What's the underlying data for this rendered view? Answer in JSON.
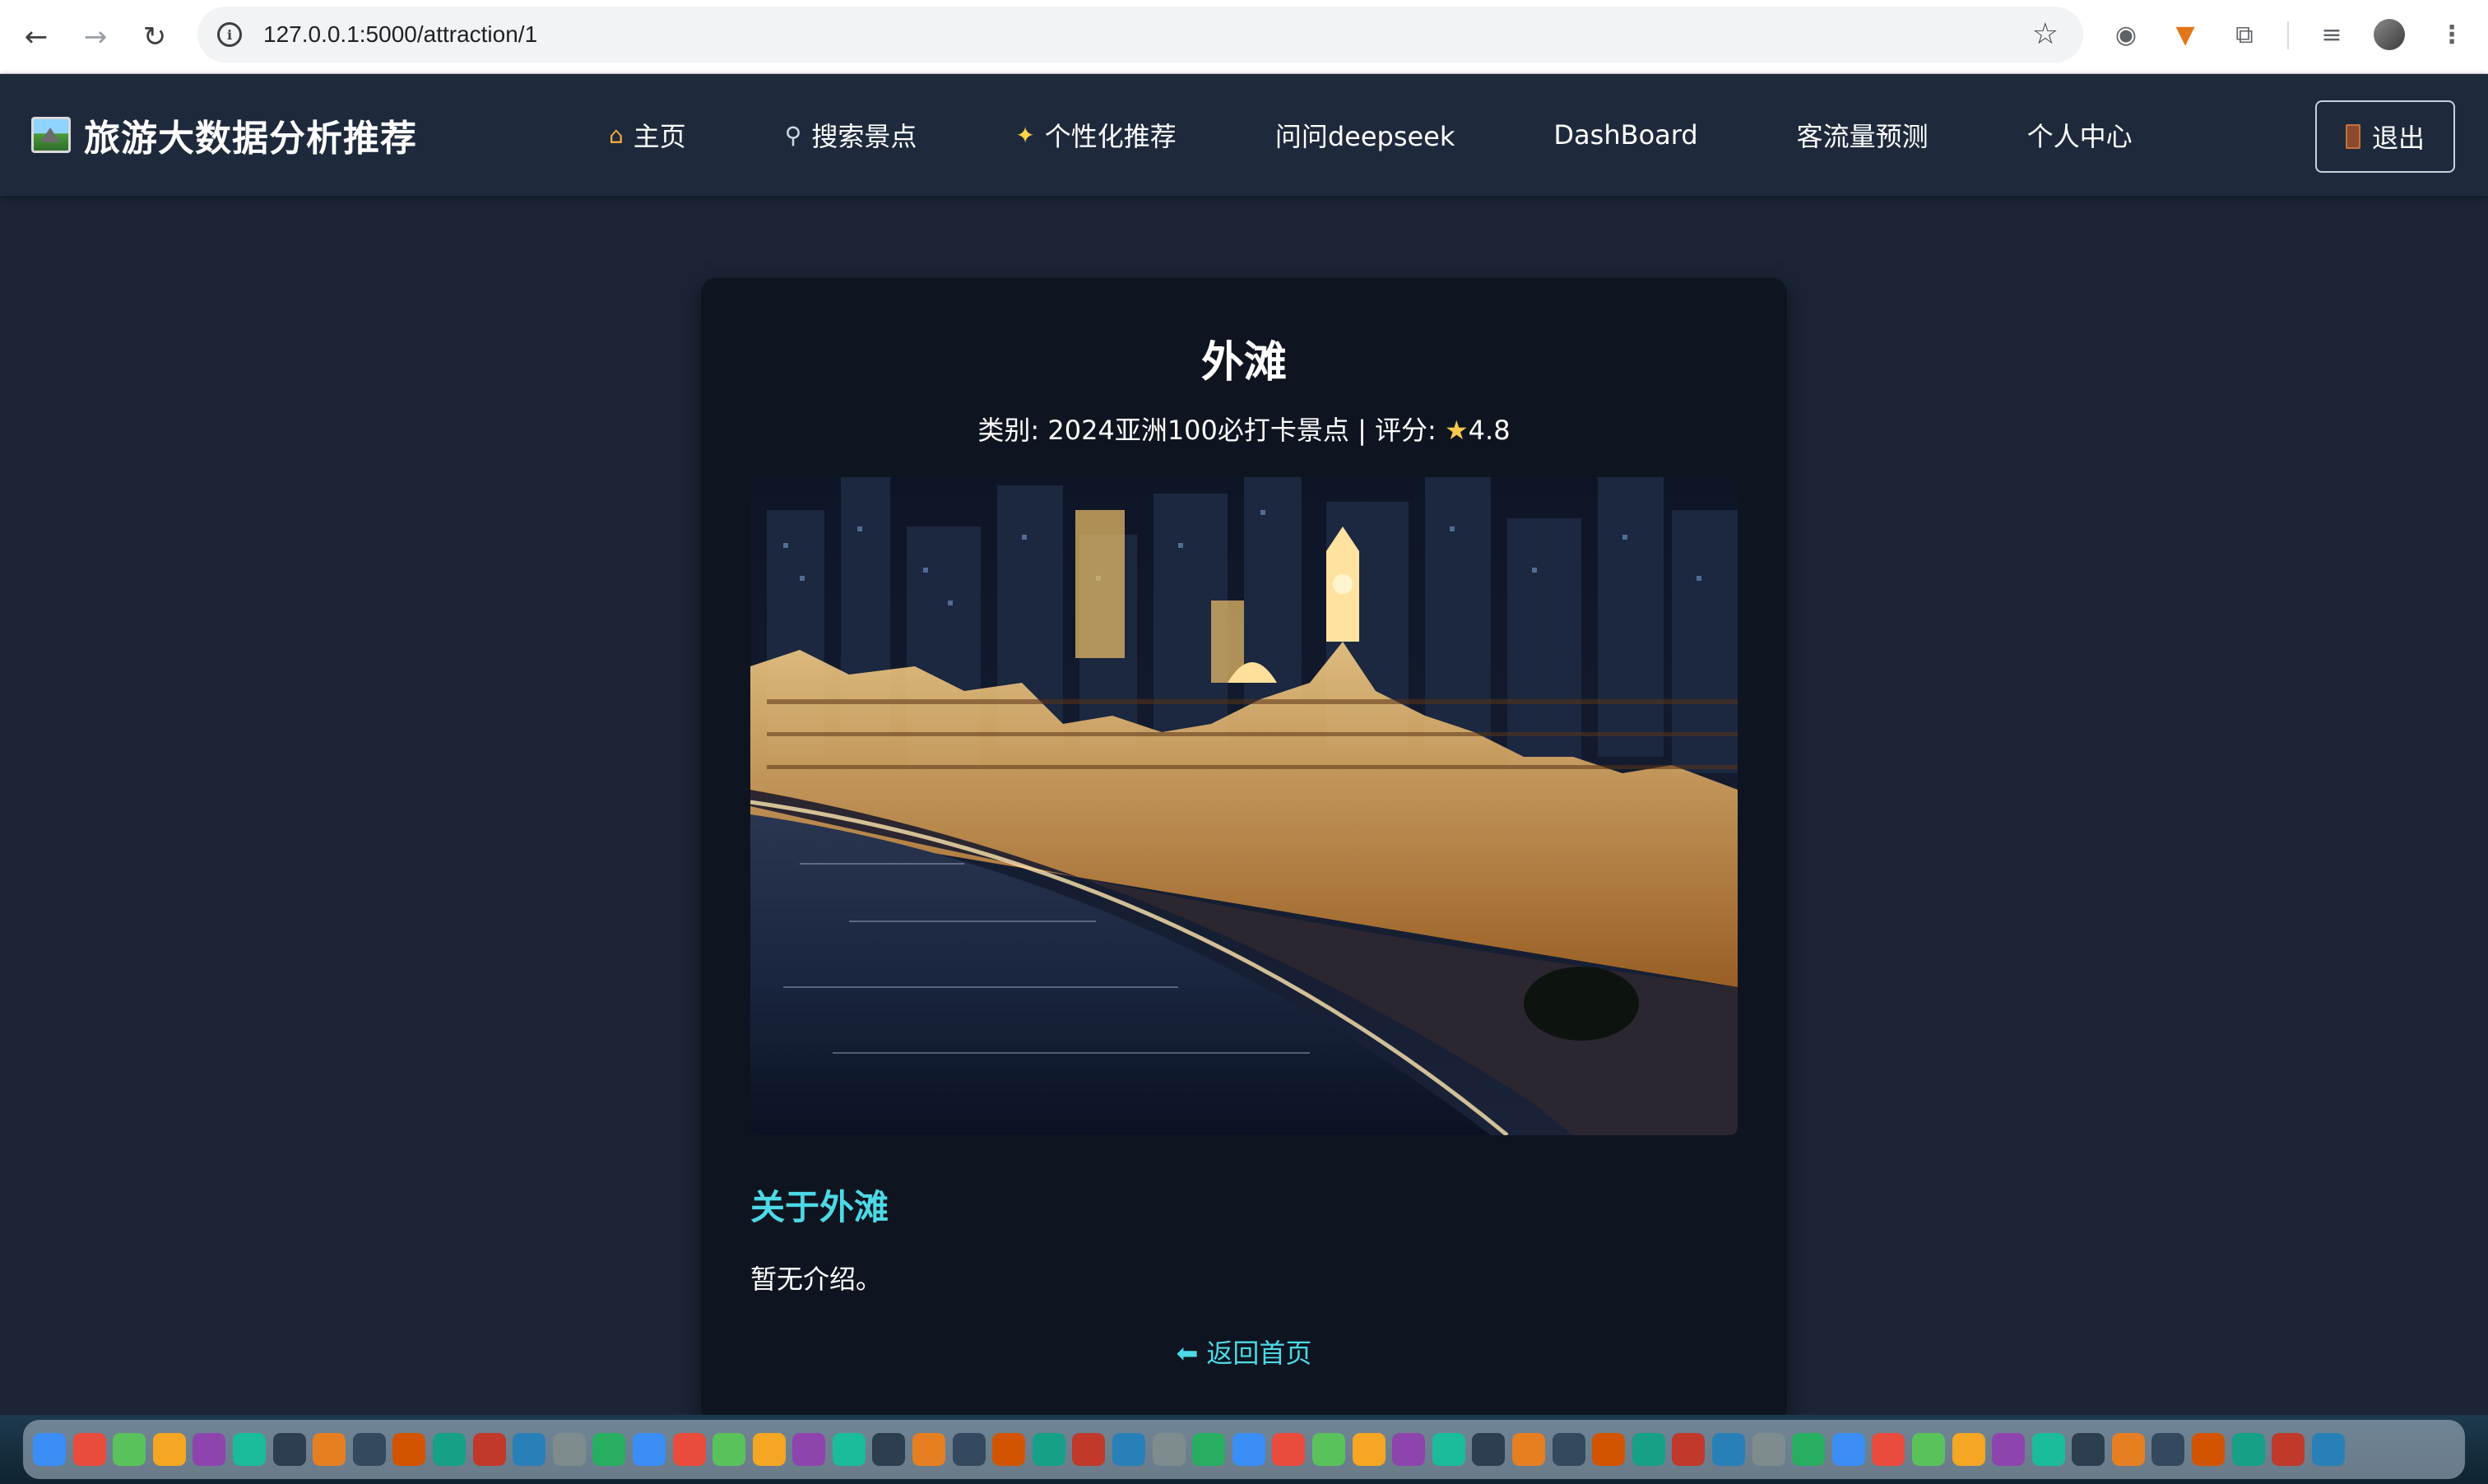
{
  "browser": {
    "url": "127.0.0.1:5000/attraction/1"
  },
  "header": {
    "brand": "旅游大数据分析推荐",
    "nav": [
      {
        "label": "主页",
        "icon": "home-icon"
      },
      {
        "label": "搜索景点",
        "icon": "search-icon"
      },
      {
        "label": "个性化推荐",
        "icon": "sparkles-icon"
      },
      {
        "label": "问问deepseek"
      },
      {
        "label": "DashBoard"
      },
      {
        "label": "客流量预测"
      },
      {
        "label": "个人中心"
      }
    ],
    "logout": "退出"
  },
  "attraction": {
    "name": "外滩",
    "meta_prefix": "类别: 2024亚洲100必打卡景点 | 评分: ",
    "rating": "4.8",
    "about_title": "关于外滩",
    "description": "暂无介绍。",
    "back_link": "返回首页"
  },
  "colors": {
    "accent": "#4dd9e6",
    "page_bg": "#1b2536",
    "header_bg": "#1e2a3c",
    "card_bg": "#0f1520"
  }
}
